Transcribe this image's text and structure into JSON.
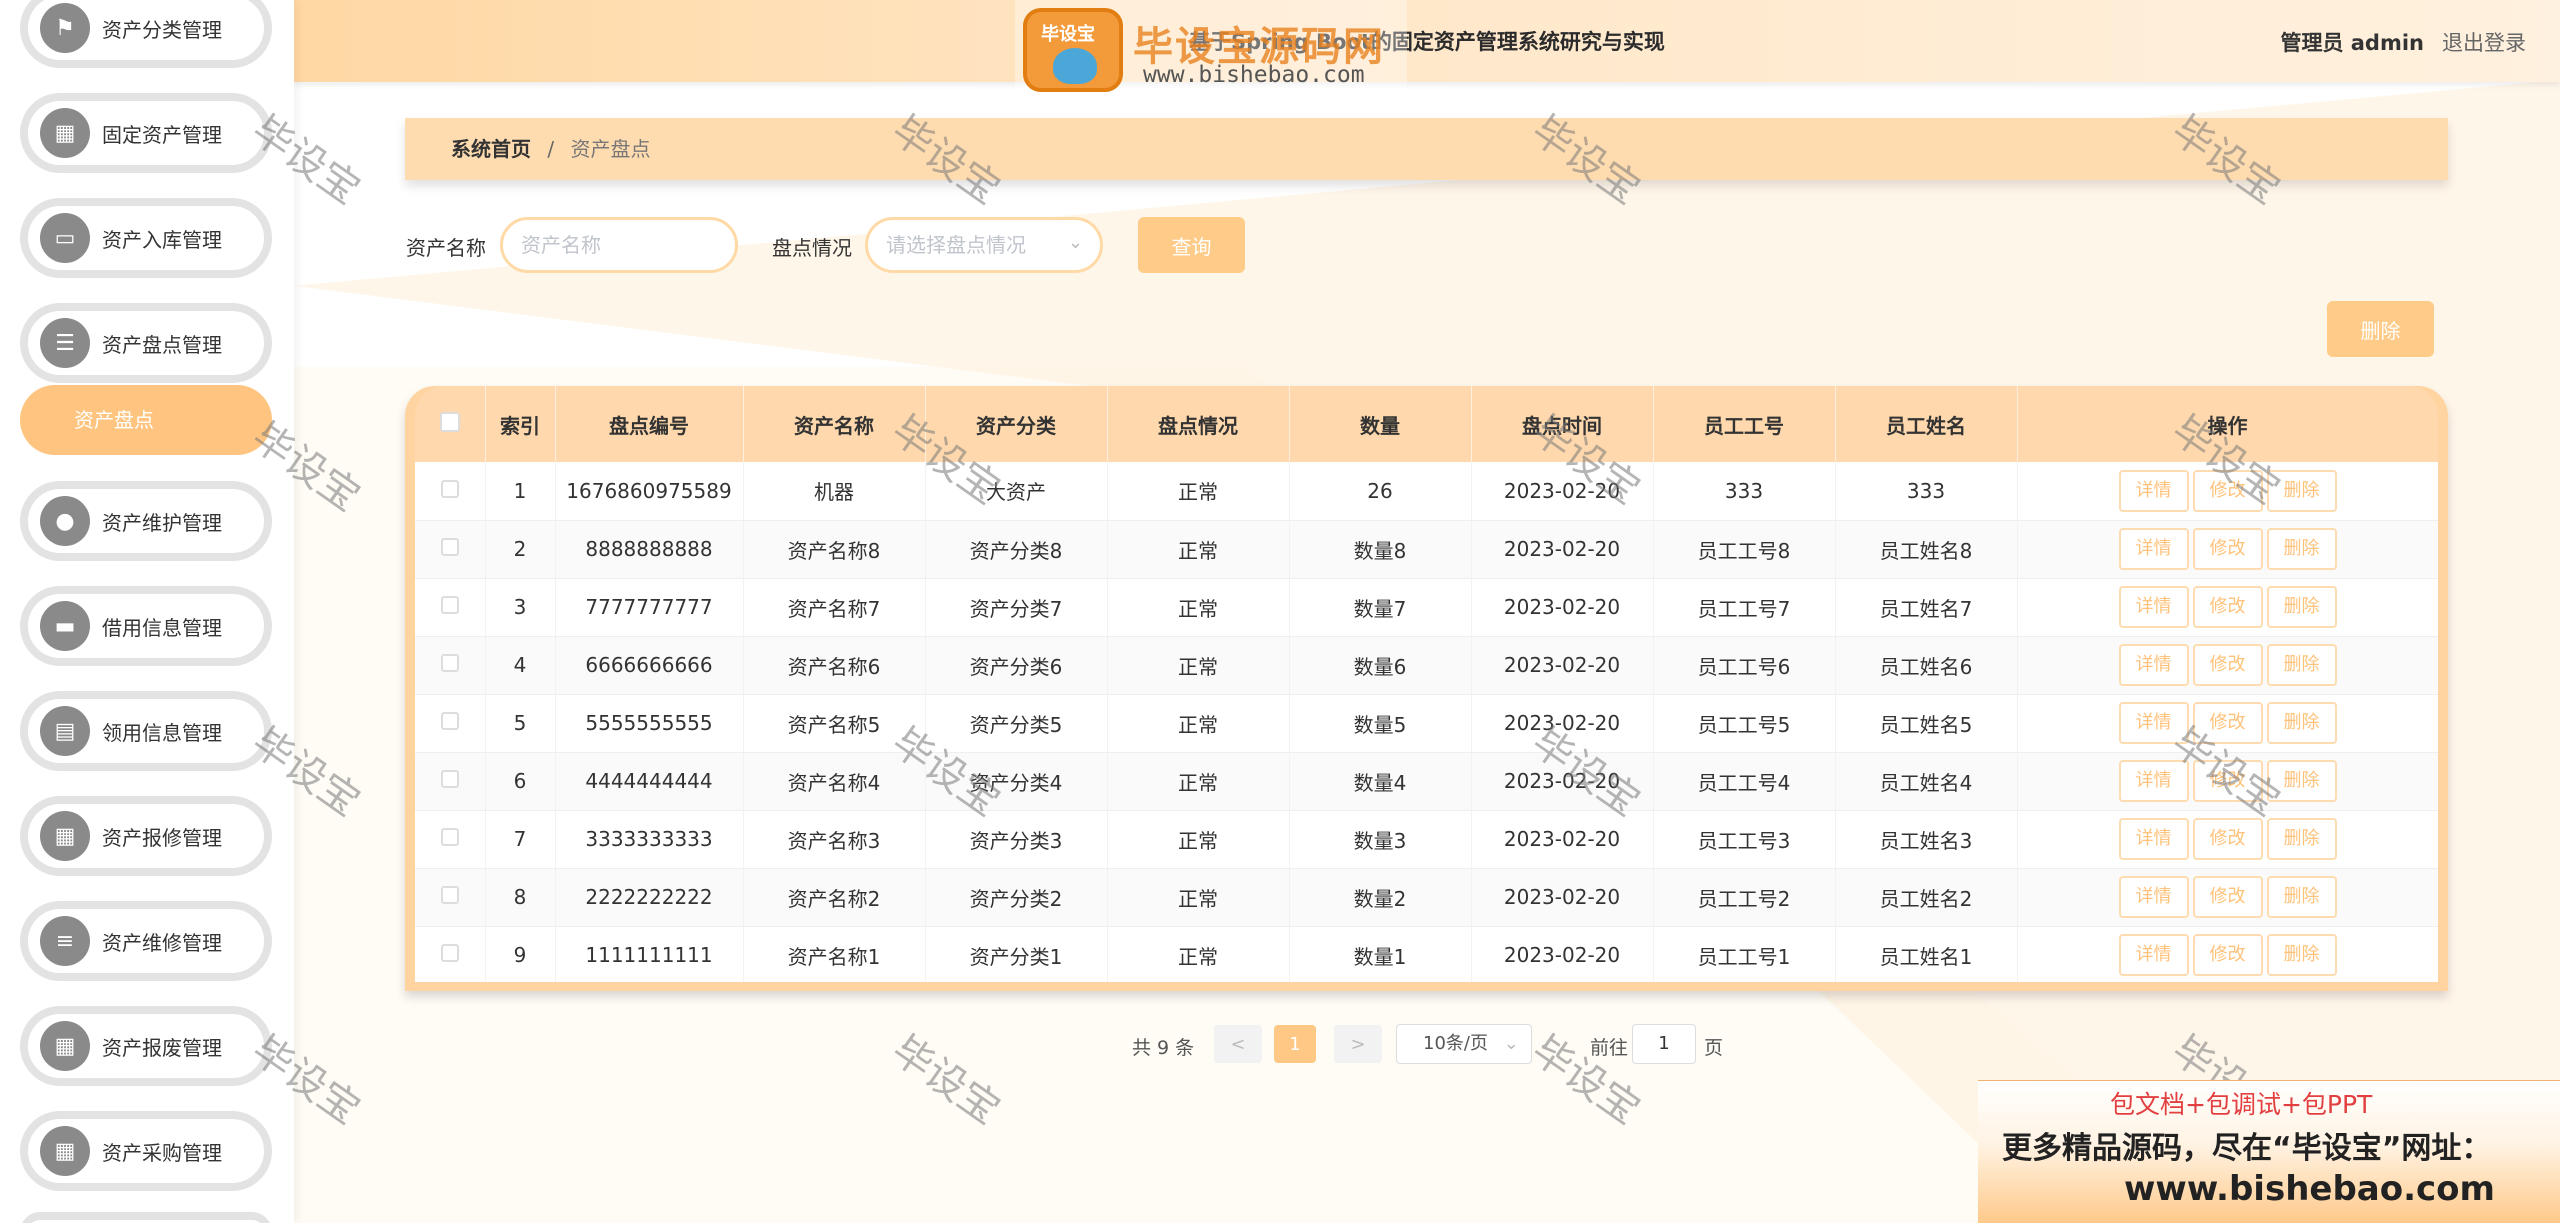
{
  "header": {
    "title": "基于Spring Boot的固定资产管理系统研究与实现",
    "user": "管理员 admin",
    "logout": "退出登录"
  },
  "watermark": {
    "badge": "毕设宝",
    "brand": "毕设宝源码网",
    "url": "www.bishebao.com",
    "text": "毕设宝"
  },
  "sidebar": {
    "items": [
      {
        "label": "资产分类管理",
        "icon": "flag-icon"
      },
      {
        "label": "固定资产管理",
        "icon": "grid-icon"
      },
      {
        "label": "资产入库管理",
        "icon": "chat-icon"
      },
      {
        "label": "资产盘点管理",
        "icon": "list-icon"
      },
      {
        "label": "资产维护管理",
        "icon": "user-icon"
      },
      {
        "label": "借用信息管理",
        "icon": "ticket-icon"
      },
      {
        "label": "领用信息管理",
        "icon": "clipboard-icon"
      },
      {
        "label": "资产报修管理",
        "icon": "grid-icon"
      },
      {
        "label": "资产维修管理",
        "icon": "sliders-icon"
      },
      {
        "label": "资产报废管理",
        "icon": "grid-icon"
      },
      {
        "label": "资产采购管理",
        "icon": "grid-icon"
      }
    ],
    "active_sub": "资产盘点"
  },
  "breadcrumb": {
    "home": "系统首页",
    "sep": "/",
    "current": "资产盘点"
  },
  "search": {
    "name_label": "资产名称",
    "name_placeholder": "资产名称",
    "status_label": "盘点情况",
    "status_placeholder": "请选择盘点情况",
    "query_button": "查询",
    "delete_button": "删除"
  },
  "table": {
    "columns": [
      "索引",
      "盘点编号",
      "资产名称",
      "资产分类",
      "盘点情况",
      "数量",
      "盘点时间",
      "员工工号",
      "员工姓名",
      "操作"
    ],
    "rows": [
      [
        "1",
        "1676860975589",
        "机器",
        "大资产",
        "正常",
        "26",
        "2023-02-20",
        "333",
        "333"
      ],
      [
        "2",
        "8888888888",
        "资产名称8",
        "资产分类8",
        "正常",
        "数量8",
        "2023-02-20",
        "员工工号8",
        "员工姓名8"
      ],
      [
        "3",
        "7777777777",
        "资产名称7",
        "资产分类7",
        "正常",
        "数量7",
        "2023-02-20",
        "员工工号7",
        "员工姓名7"
      ],
      [
        "4",
        "6666666666",
        "资产名称6",
        "资产分类6",
        "正常",
        "数量6",
        "2023-02-20",
        "员工工号6",
        "员工姓名6"
      ],
      [
        "5",
        "5555555555",
        "资产名称5",
        "资产分类5",
        "正常",
        "数量5",
        "2023-02-20",
        "员工工号5",
        "员工姓名5"
      ],
      [
        "6",
        "4444444444",
        "资产名称4",
        "资产分类4",
        "正常",
        "数量4",
        "2023-02-20",
        "员工工号4",
        "员工姓名4"
      ],
      [
        "7",
        "3333333333",
        "资产名称3",
        "资产分类3",
        "正常",
        "数量3",
        "2023-02-20",
        "员工工号3",
        "员工姓名3"
      ],
      [
        "8",
        "2222222222",
        "资产名称2",
        "资产分类2",
        "正常",
        "数量2",
        "2023-02-20",
        "员工工号2",
        "员工姓名2"
      ],
      [
        "9",
        "1111111111",
        "资产名称1",
        "资产分类1",
        "正常",
        "数量1",
        "2023-02-20",
        "员工工号1",
        "员工姓名1"
      ]
    ],
    "actions": [
      "详情",
      "修改",
      "删除"
    ]
  },
  "pagination": {
    "total": "共 9 条",
    "prev": "<",
    "page": "1",
    "next": ">",
    "size": "10条/页",
    "goto_prefix": "前往",
    "goto_value": "1",
    "goto_suffix": "页"
  },
  "promo": {
    "line1": "包文档+包调试+包PPT",
    "line2": "更多精品源码，尽在“毕设宝”网址：",
    "line3": "www.bishebao.com"
  },
  "colors": {
    "accent": "#ffc580",
    "header_bg": "#ffd8a3",
    "table_header": "#ffd9ad"
  }
}
